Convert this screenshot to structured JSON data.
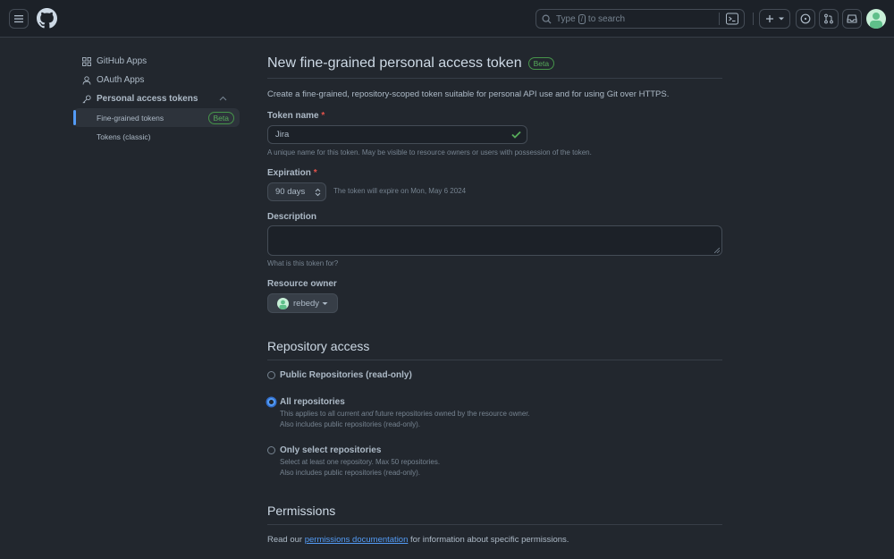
{
  "header": {
    "search_prefix": "Type",
    "search_key": "/",
    "search_suffix": "to search"
  },
  "sidebar": {
    "items": [
      {
        "label": "GitHub Apps"
      },
      {
        "label": "OAuth Apps"
      },
      {
        "label": "Personal access tokens"
      }
    ],
    "subitems": [
      {
        "label": "Fine-grained tokens",
        "badge": "Beta"
      },
      {
        "label": "Tokens (classic)"
      }
    ]
  },
  "main": {
    "title": "New fine-grained personal access token",
    "title_badge": "Beta",
    "intro": "Create a fine-grained, repository-scoped token suitable for personal API use and for using Git over HTTPS.",
    "token_name": {
      "label": "Token name",
      "required": "*",
      "value": "Jira",
      "note": "A unique name for this token. May be visible to resource owners or users with possession of the token."
    },
    "expiration": {
      "label": "Expiration",
      "required": "*",
      "value": "90 days",
      "note": "The token will expire on Mon, May 6 2024"
    },
    "description": {
      "label": "Description",
      "value": "",
      "note": "What is this token for?"
    },
    "resource_owner": {
      "label": "Resource owner",
      "value": "rebedy"
    },
    "repository_access": {
      "title": "Repository access",
      "options": [
        {
          "label": "Public Repositories (read-only)",
          "checked": false
        },
        {
          "label": "All repositories",
          "checked": true,
          "desc1_a": "This applies to all current ",
          "desc1_em": "and",
          "desc1_b": " future repositories owned by the resource owner.",
          "desc2": "Also includes public repositories (read-only)."
        },
        {
          "label": "Only select repositories",
          "checked": false,
          "desc1": "Select at least one repository. Max 50 repositories.",
          "desc2": "Also includes public repositories (read-only)."
        }
      ]
    },
    "permissions": {
      "title": "Permissions",
      "text_before": "Read our ",
      "link": "permissions documentation",
      "text_after": " for information about specific permissions."
    }
  },
  "colors": {
    "bg": "#22272e",
    "header_bg": "#1c2128",
    "accent": "#539bf5",
    "success": "#57ab5a",
    "danger": "#e5534b"
  }
}
